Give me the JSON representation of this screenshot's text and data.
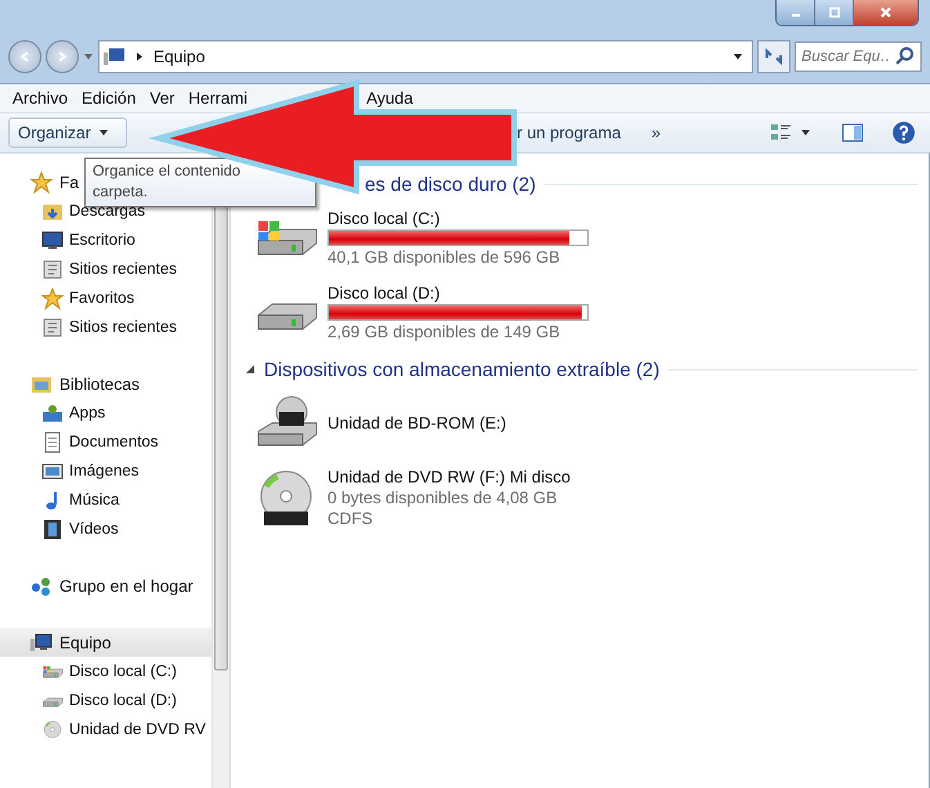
{
  "address_bar": {
    "path": "Equipo"
  },
  "search": {
    "placeholder": "Buscar Equ…"
  },
  "menu": [
    "Archivo",
    "Edición",
    "Ver",
    "Herrami",
    "Ayuda"
  ],
  "toolbar": {
    "organize": "Organizar",
    "partial_command": "r un programa",
    "more": "»"
  },
  "tooltip": {
    "lines": [
      "Organice el contenido",
      "carpeta."
    ]
  },
  "sidebar": [
    {
      "label": "Fa",
      "kind": "star",
      "selected": false,
      "children": [
        {
          "label": "Descargas",
          "kind": "downloads",
          "selected": false
        },
        {
          "label": "Escritorio",
          "kind": "desktop",
          "selected": false
        },
        {
          "label": "Sitios recientes",
          "kind": "recent",
          "selected": false
        },
        {
          "label": "Favoritos",
          "kind": "star",
          "selected": false
        },
        {
          "label": "Sitios recientes",
          "kind": "recent",
          "selected": false
        }
      ]
    },
    {
      "label": "Bibliotecas",
      "kind": "library",
      "selected": false,
      "children": [
        {
          "label": "Apps",
          "kind": "apps",
          "selected": false
        },
        {
          "label": "Documentos",
          "kind": "document",
          "selected": false
        },
        {
          "label": "Imágenes",
          "kind": "pictures",
          "selected": false
        },
        {
          "label": "Música",
          "kind": "music",
          "selected": false
        },
        {
          "label": "Vídeos",
          "kind": "video",
          "selected": false
        }
      ]
    },
    {
      "label": "Grupo en el hogar",
      "kind": "homegroup",
      "selected": false
    },
    {
      "label": "Equipo",
      "kind": "computer",
      "selected": true,
      "children": [
        {
          "label": "Disco local (C:)",
          "kind": "windisk",
          "selected": false
        },
        {
          "label": "Disco local (D:)",
          "kind": "disk",
          "selected": false
        },
        {
          "label": "Unidad de DVD RV",
          "kind": "dvd",
          "selected": false
        }
      ]
    }
  ],
  "sections": [
    {
      "title": "es de disco duro (2)",
      "items": [
        {
          "kind": "windisk",
          "name": "Disco local (C:)",
          "level": 0.93,
          "details": [
            "40,1 GB disponibles de 596 GB"
          ]
        },
        {
          "kind": "disk",
          "name": "Disco local (D:)",
          "level": 0.98,
          "details": [
            "2,69 GB disponibles de 149 GB"
          ]
        }
      ]
    },
    {
      "title": "Dispositivos con almacenamiento extraíble (2)",
      "items": [
        {
          "kind": "bd",
          "name": "Unidad de BD-ROM (E:)"
        },
        {
          "kind": "dvd",
          "name": "Unidad de DVD RW (F:) Mi disco",
          "details": [
            "0 bytes disponibles de 4,08 GB",
            "CDFS"
          ]
        }
      ]
    }
  ]
}
